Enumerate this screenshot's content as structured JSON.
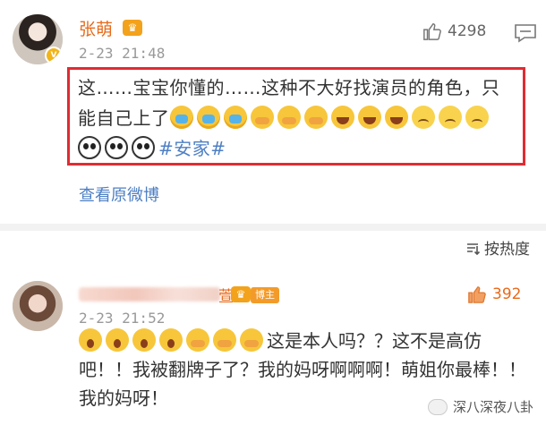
{
  "post": {
    "username": "张萌",
    "timestamp": "2-23 21:48",
    "like_count": "4298",
    "text_part1": "这……宝宝你懂的……这种不大好找演员的角色，只能自己上了",
    "text_tag": "#安家#",
    "view_original": "查看原微博"
  },
  "sort": {
    "label": "按热度"
  },
  "comment": {
    "timestamp": "2-23 21:52",
    "name_suffix": "萱",
    "host_tag": "博主",
    "like_count": "392",
    "text": "这是本人吗？？这不是高仿吧！！我被翻牌子了？我的妈呀啊啊啊！萌姐你最棒！！我的妈呀！"
  },
  "watermark": {
    "text": "深八深夜八卦"
  },
  "colors": {
    "accent_orange": "#e86a1a",
    "link_blue": "#4d7fc4",
    "highlight_red": "#e02c32"
  },
  "icons": [
    "avatar-vip-badge-icon",
    "crown-icon",
    "thumb-up-icon",
    "comment-icon",
    "sort-icon",
    "emoji-icon"
  ]
}
